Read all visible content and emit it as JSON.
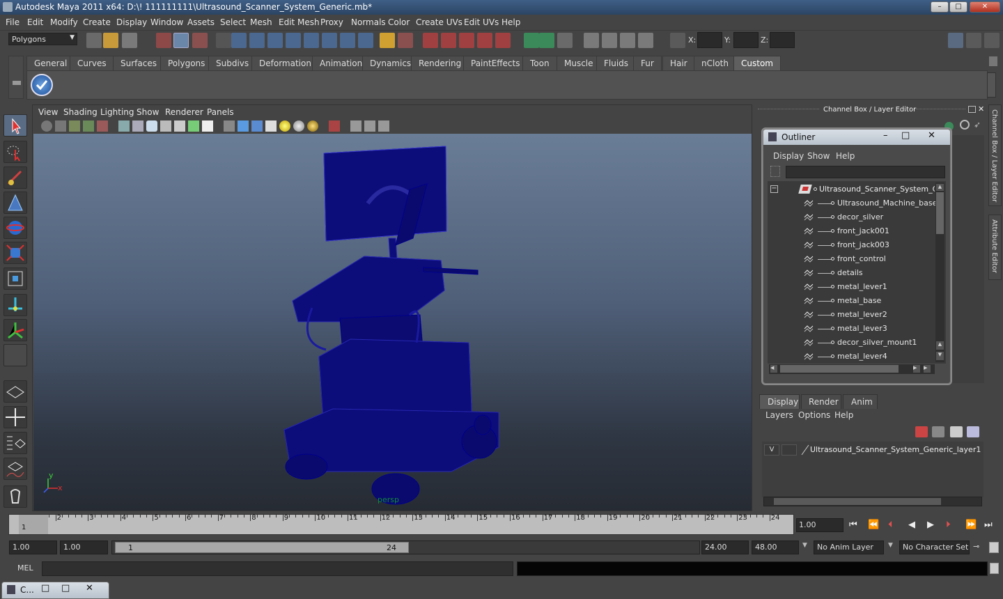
{
  "window": {
    "title": "Autodesk Maya 2011 x64: D:\\! 111111111\\Ultrasound_Scanner_System_Generic.mb*",
    "minimize": "–",
    "maximize": "□",
    "close": "✕"
  },
  "menubar": [
    "File",
    "Edit",
    "Modify",
    "Create",
    "Display",
    "Window",
    "Assets",
    "Select",
    "Mesh",
    "Edit Mesh",
    "Proxy",
    "Normals",
    "Color",
    "Create UVs",
    "Edit UVs",
    "Help"
  ],
  "statusline": {
    "mode": "Polygons",
    "x_label": "X:",
    "y_label": "Y:",
    "z_label": "Z:"
  },
  "shelf": {
    "tabs": [
      "General",
      "Curves",
      "Surfaces",
      "Polygons",
      "Subdivs",
      "Deformation",
      "Animation",
      "Dynamics",
      "Rendering",
      "PaintEffects",
      "Toon",
      "Muscle",
      "Fluids",
      "Fur",
      "Hair",
      "nCloth",
      "Custom"
    ],
    "active": "Custom"
  },
  "viewport": {
    "menus": [
      "View",
      "Shading",
      "Lighting",
      "Show",
      "Renderer",
      "Panels"
    ],
    "camera_label": "persp",
    "axis_y": "y",
    "axis_x": "x",
    "wire_color": "#00008b"
  },
  "channelbox": {
    "title": "Channel Box / Layer Editor",
    "side_tab_1": "Channel Box / Layer Editor",
    "side_tab_2": "Attribute Editor"
  },
  "outliner": {
    "title": "Outliner",
    "menus": [
      "Display",
      "Show",
      "Help"
    ],
    "root": "Ultrasound_Scanner_System_Generic",
    "items": [
      "Ultrasound_Machine_base",
      "decor_silver",
      "front_jack001",
      "front_jack003",
      "front_control",
      "details",
      "metal_lever1",
      "metal_base",
      "metal_lever2",
      "metal_lever3",
      "decor_silver_mount1",
      "metal_lever4"
    ],
    "collapse_glyph": "−"
  },
  "layer_editor": {
    "tabs": [
      "Display",
      "Render",
      "Anim"
    ],
    "active_tab": "Display",
    "menus": [
      "Layers",
      "Options",
      "Help"
    ],
    "layers": [
      {
        "visibility": "V",
        "name": "Ultrasound_Scanner_System_Generic_layer1"
      }
    ]
  },
  "timeslider": {
    "ticks": [
      "1",
      "2",
      "3",
      "4",
      "5",
      "6",
      "7",
      "8",
      "9",
      "10",
      "11",
      "12",
      "13",
      "14",
      "15",
      "16",
      "17",
      "18",
      "19",
      "20",
      "21",
      "22",
      "23",
      "24"
    ],
    "current_frame": "1",
    "current_time": "1.00"
  },
  "range": {
    "start_time": "1.00",
    "playback_start": "1.00",
    "slider_start": "1",
    "slider_end": "24",
    "playback_end": "24.00",
    "end_time": "48.00",
    "anim_layer": "No Anim Layer",
    "char_set": "No Character Set"
  },
  "commandline": {
    "label": "MEL"
  },
  "minimized": {
    "label": "C..."
  }
}
